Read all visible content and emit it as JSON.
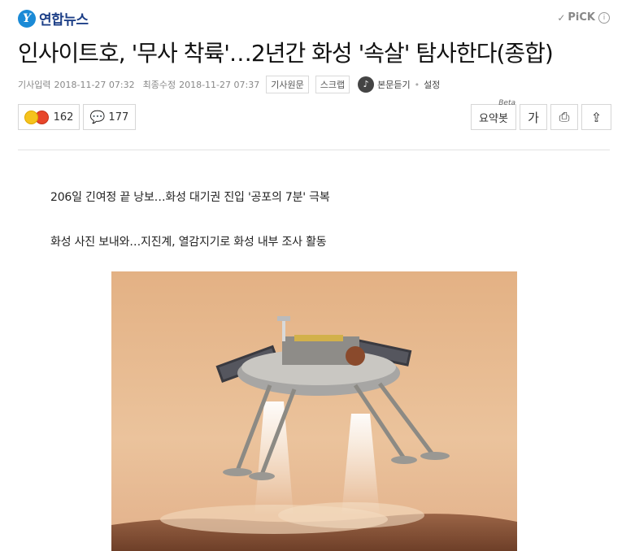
{
  "header": {
    "logo_mark": "Y",
    "logo_text": "연합뉴스",
    "pick_check": "✓",
    "pick_label": "PiCK",
    "pick_info": "i"
  },
  "article": {
    "title": "인사이트호, '무사 착륙'…2년간 화성 '속살' 탐사한다(종합)",
    "input_label": "기사입력",
    "input_time": "2018-11-27 07:32",
    "modified_label": "최종수정",
    "modified_time": "2018-11-27 07:37",
    "source_button": "기사원문",
    "scrap_button": "스크랩",
    "listen_icon": "♪",
    "listen_label": "본문듣기",
    "listen_dot": "•",
    "settings_label": "설정",
    "subheads": [
      "206일 긴여정 끝 낭보…화성 대기권 진입 '공포의 7분' 극복",
      "화성 사진 보내와…지진계, 열감지기로 화성 내부 조사 활동"
    ]
  },
  "actions": {
    "reaction_count": "162",
    "comment_icon": "💬",
    "comment_count": "177",
    "summary_label": "요약봇",
    "summary_beta": "Beta",
    "font_button": "가",
    "print_icon": "⎙",
    "share_icon": "⇪"
  },
  "colors": {
    "brand_blue": "#1a8ad6",
    "logo_text": "#1d3f87",
    "sky": "#e6b98a",
    "ground": "#7a4a30"
  },
  "image": {
    "subject": "lander-descending-over-mars-illustration"
  }
}
